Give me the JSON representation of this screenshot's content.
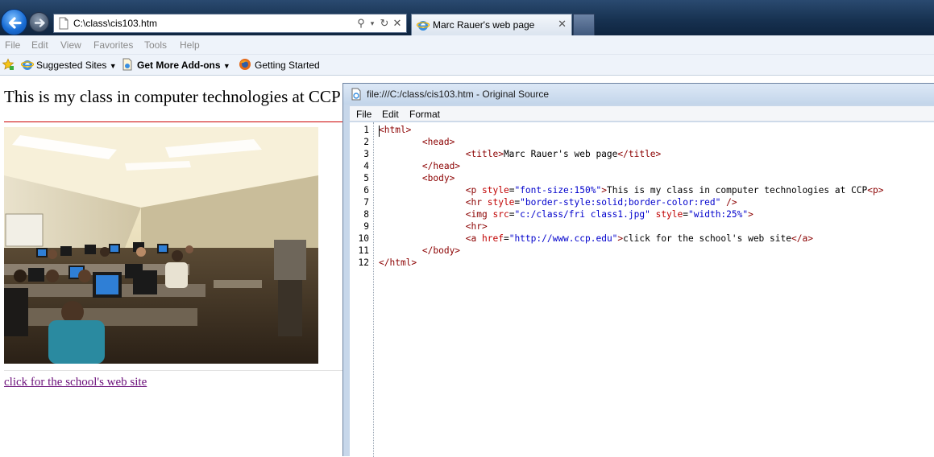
{
  "browser": {
    "address": "C:\\class\\cis103.htm",
    "tab_title": "Marc Rauer's web page"
  },
  "menu": [
    "File",
    "Edit",
    "View",
    "Favorites",
    "Tools",
    "Help"
  ],
  "favorites": {
    "suggested": "Suggested Sites",
    "addons": "Get More Add-ons",
    "started": "Getting Started"
  },
  "page": {
    "heading": "This is my class in computer technologies at CCP",
    "link": "click for the school's web site"
  },
  "source": {
    "title": "file:///C:/class/cis103.htm - Original Source",
    "menu": [
      "File",
      "Edit",
      "Format"
    ],
    "line_numbers": [
      "1",
      "2",
      "3",
      "4",
      "5",
      "6",
      "7",
      "8",
      "9",
      "10",
      "11",
      "12"
    ],
    "lines": [
      [
        [
          "<html>",
          "tg"
        ]
      ],
      [
        [
          "        ",
          "tx"
        ],
        [
          "<head>",
          "tg"
        ]
      ],
      [
        [
          "                ",
          "tx"
        ],
        [
          "<title>",
          "tg"
        ],
        [
          "Marc Rauer's web page",
          "tx"
        ],
        [
          "</title>",
          "tg"
        ]
      ],
      [
        [
          "        ",
          "tx"
        ],
        [
          "</head>",
          "tg"
        ]
      ],
      [
        [
          "        ",
          "tx"
        ],
        [
          "<body>",
          "tg"
        ]
      ],
      [
        [
          "                ",
          "tx"
        ],
        [
          "<p ",
          "tg"
        ],
        [
          "style",
          "at"
        ],
        [
          "=",
          "tx"
        ],
        [
          "\"font-size:150%\"",
          "vl"
        ],
        [
          ">",
          "tg"
        ],
        [
          "This is my class in computer technologies at CCP",
          "tx"
        ],
        [
          "<p>",
          "tg"
        ]
      ],
      [
        [
          "                ",
          "tx"
        ],
        [
          "<hr ",
          "tg"
        ],
        [
          "style",
          "at"
        ],
        [
          "=",
          "tx"
        ],
        [
          "\"border-style:solid;border-color:red\"",
          "vl"
        ],
        [
          " />",
          "tg"
        ]
      ],
      [
        [
          "                ",
          "tx"
        ],
        [
          "<img ",
          "tg"
        ],
        [
          "src",
          "at"
        ],
        [
          "=",
          "tx"
        ],
        [
          "\"c:/class/fri class1.jpg\"",
          "vl"
        ],
        [
          " ",
          "tx"
        ],
        [
          "style",
          "at"
        ],
        [
          "=",
          "tx"
        ],
        [
          "\"width:25%\"",
          "vl"
        ],
        [
          ">",
          "tg"
        ]
      ],
      [
        [
          "                ",
          "tx"
        ],
        [
          "<hr>",
          "tg"
        ]
      ],
      [
        [
          "                ",
          "tx"
        ],
        [
          "<a ",
          "tg"
        ],
        [
          "href",
          "at"
        ],
        [
          "=",
          "tx"
        ],
        [
          "\"http://www.ccp.edu\"",
          "vl"
        ],
        [
          ">",
          "tg"
        ],
        [
          "click for the school's web site",
          "tx"
        ],
        [
          "</a>",
          "tg"
        ]
      ],
      [
        [
          "        ",
          "tx"
        ],
        [
          "</body>",
          "tg"
        ]
      ],
      [
        [
          "</html>",
          "tg"
        ]
      ]
    ]
  }
}
